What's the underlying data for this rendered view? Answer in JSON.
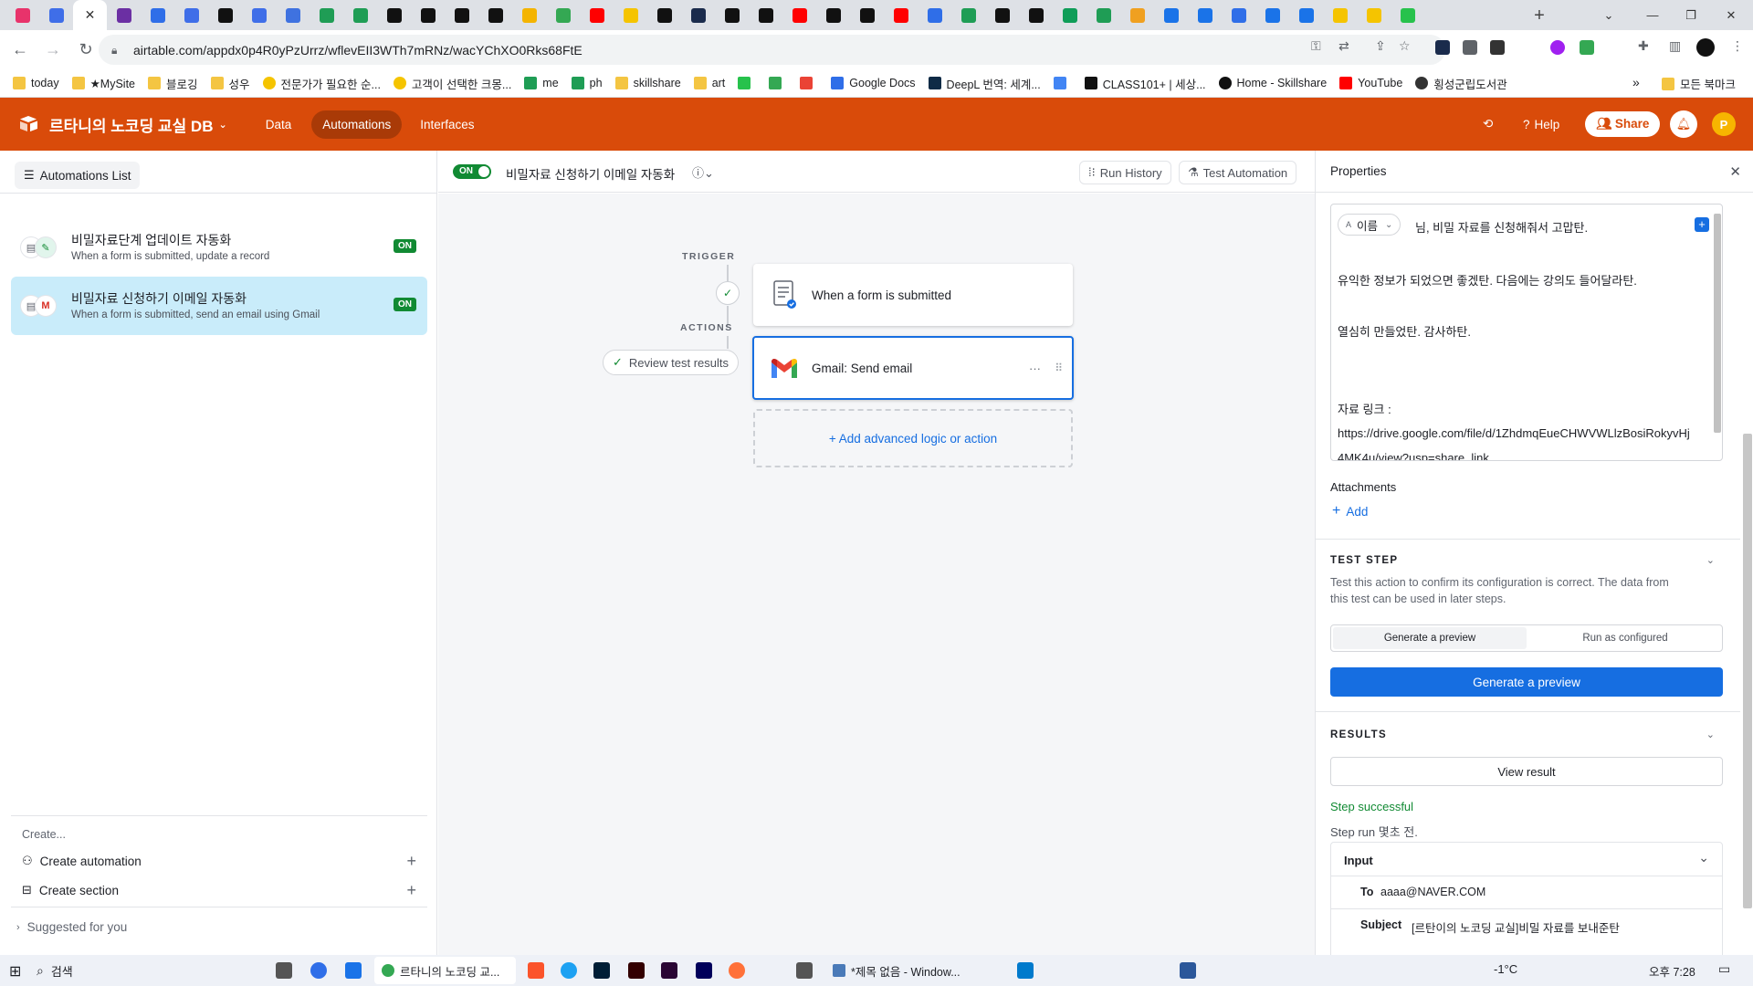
{
  "browser": {
    "active_tab_close": "✕",
    "new_tab": "+",
    "url": "airtable.com/appdx0p4R0yPzUrrz/wflevEII3WTh7mRNz/wacYChXO0Rks68FtE",
    "tab_icon_colors": [
      "#e8336b",
      "#3f6ee8",
      "#e8336b",
      "#6b2fa3",
      "#2f6ee8",
      "#3f6ee8",
      "#111111",
      "#3f6ee8",
      "#3f72e0",
      "#1f9d55",
      "#1f9d55",
      "#111111",
      "#111111",
      "#111111",
      "#111111",
      "#f4b400",
      "#34a853",
      "#ff0000",
      "#f5c400",
      "#111111",
      "#1a2b4c",
      "#111111",
      "#111111",
      "#ff0000",
      "#111111",
      "#111111",
      "#ff0000",
      "#2f6ee8",
      "#1f9d55",
      "#111111",
      "#111111",
      "#0f9d58",
      "#1f9d55",
      "#f0a020",
      "#1a73e8",
      "#1a73e8",
      "#2f6ee8",
      "#1a73e8",
      "#1a73e8",
      "#f5c400",
      "#f5c400",
      "#27c24c"
    ],
    "bookmarks": [
      {
        "label": "today",
        "icon": "folder-icon"
      },
      {
        "label": "★MySite",
        "icon": "folder-icon"
      },
      {
        "label": "블로깅",
        "icon": "folder-icon"
      },
      {
        "label": "성우",
        "icon": "folder-icon"
      },
      {
        "label": "전문가가 필요한 순...",
        "icon": "coin-icon"
      },
      {
        "label": "고객이 선택한 크몽...",
        "icon": "coin-icon"
      },
      {
        "label": "me",
        "icon": "sheets-icon"
      },
      {
        "label": "ph",
        "icon": "sheets-icon"
      },
      {
        "label": "skillshare",
        "icon": "folder-icon"
      },
      {
        "label": "art",
        "icon": "folder-icon"
      },
      {
        "label": "",
        "icon": "n-icon"
      },
      {
        "label": "",
        "icon": "drive-icon"
      },
      {
        "label": "",
        "icon": "gmail-icon"
      },
      {
        "label": "Google Docs",
        "icon": "docs-icon"
      },
      {
        "label": "DeepL 번역: 세계...",
        "icon": "deepl-icon"
      },
      {
        "label": "",
        "icon": "translate-icon"
      },
      {
        "label": "CLASS101+ | 세상...",
        "icon": "class101-icon"
      },
      {
        "label": "Home - Skillshare",
        "icon": "skillshare-icon"
      },
      {
        "label": "YouTube",
        "icon": "youtube-icon"
      },
      {
        "label": "횡성군립도서관",
        "icon": "library-icon"
      }
    ],
    "bookmarks_overflow": "»",
    "other_bookmarks": "모든 북마크"
  },
  "header": {
    "base_name": "르타니의 노코딩 교실 DB",
    "nav": [
      "Data",
      "Automations",
      "Interfaces"
    ],
    "active_nav": "Automations",
    "help": "Help",
    "share": "Share",
    "avatar_letter": "P",
    "accent": "#d94b0a"
  },
  "sidebar": {
    "list_button": "Automations List",
    "items": [
      {
        "title": "비밀자료단계 업데이트 자동화",
        "desc": "When a form is submitted, update a record",
        "status": "ON",
        "selected": false
      },
      {
        "title": "비밀자료 신청하기 이메일 자동화",
        "desc": "When a form is submitted, send an email using Gmail",
        "status": "ON",
        "selected": true
      }
    ],
    "create_label": "Create...",
    "create_automation": "Create automation",
    "create_section": "Create section",
    "suggested": "Suggested for you"
  },
  "canvas": {
    "toggle": "ON",
    "automation_name": "비밀자료 신청하기 이메일 자동화",
    "run_history": "Run History",
    "test_automation": "Test Automation",
    "trigger_label": "TRIGGER",
    "actions_label": "ACTIONS",
    "trigger_card": "When a form is submitted",
    "action_card": "Gmail: Send email",
    "action_menu": "···",
    "review_button": "Review test results",
    "add_logic": "+ Add advanced logic or action"
  },
  "properties": {
    "title": "Properties",
    "name_chip": "이름",
    "message_lines": [
      "님, 비밀 자료를 신청해줘서 고맙탄.",
      "유익한 정보가 되었으면 좋겠탄. 다음에는 강의도 들어달라탄.",
      "열심히 만들었탄. 감사하탄.",
      "자료 링크 :",
      "https://drive.google.com/file/d/1ZhdmqEueCHWVWLlzBosiRokyvHj",
      "4MK4u/view?usp=share_link"
    ],
    "attachments_label": "Attachments",
    "add_attachment": "Add",
    "test_step_title": "TEST STEP",
    "test_step_desc_1": "Test this action to confirm its configuration is correct. The data from",
    "test_step_desc_2": "this test can be used in later steps.",
    "seg_generate": "Generate a preview",
    "seg_run": "Run as configured",
    "generate_button": "Generate a preview",
    "results_title": "RESULTS",
    "view_result": "View result",
    "step_status": "Step successful",
    "step_run": "Step run 몇초 전.",
    "input_label": "Input",
    "to_label": "To",
    "to_value": "aaaa@NAVER.COM",
    "subject_label": "Subject",
    "subject_value": "[르탄이의 노코딩 교실]비밀 자료를 보내준탄",
    "success_color": "#118a33",
    "primary_color": "#166ee1"
  },
  "taskbar": {
    "search": "검색",
    "window1": "르타니의 노코딩 교...",
    "window2": "*제목 없음 - Window...",
    "weather": "-1°C",
    "time": "오후 7:28"
  }
}
